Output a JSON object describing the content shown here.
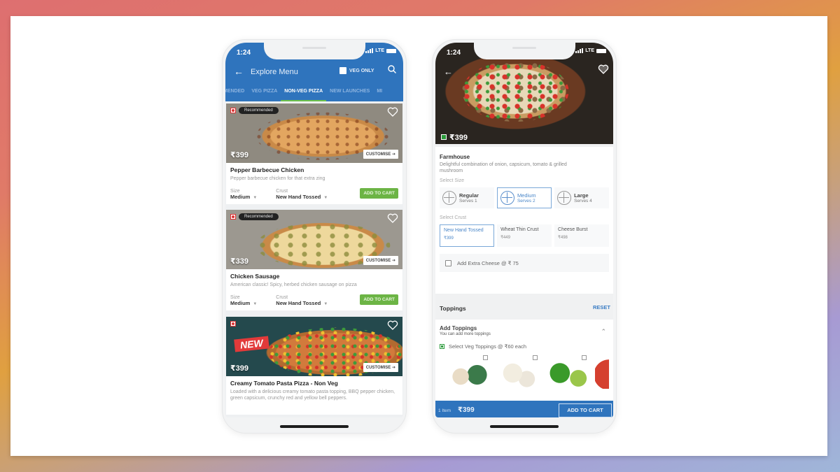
{
  "left_phone": {
    "status": {
      "time": "1:24",
      "network": "LTE"
    },
    "header": {
      "title": "Explore Menu",
      "veg_only_label": "VEG ONLY",
      "veg_only_checked": false
    },
    "tabs": [
      {
        "label": "RECOMMENDED",
        "visible_text": "MENDED",
        "active": false
      },
      {
        "label": "VEG PIZZA",
        "active": false
      },
      {
        "label": "NON-VEG PIZZA",
        "active": true
      },
      {
        "label": "NEW LAUNCHES",
        "active": false
      },
      {
        "label": "MI",
        "active": false
      }
    ],
    "items": [
      {
        "badge": "Recommended",
        "price": "₹399",
        "customise_label": "CUSTOMISE ➔",
        "name": "Pepper Barbecue Chicken",
        "description": "Pepper barbecue chicken for that extra zing",
        "size_label": "Size",
        "size_value": "Medium",
        "crust_label": "Crust",
        "crust_value": "New Hand Tossed",
        "add_to_cart": "ADD TO CART"
      },
      {
        "badge": "Recommended",
        "price": "₹339",
        "customise_label": "CUSTOMISE ➔",
        "name": "Chicken Sausage",
        "description": "American classic! Spicy, herbed chicken sausage on pizza",
        "size_label": "Size",
        "size_value": "Medium",
        "crust_label": "Crust",
        "crust_value": "New Hand Tossed",
        "add_to_cart": "ADD TO CART"
      },
      {
        "badge": "NEW",
        "price": "₹399",
        "customise_label": "CUSTOMISE ➔",
        "name": "Creamy Tomato Pasta Pizza - Non Veg",
        "description": "Loaded with a delicious creamy tomato pasta topping, BBQ pepper chicken, green capsicum, crunchy red and yellow bell peppers."
      }
    ]
  },
  "right_phone": {
    "status": {
      "time": "1:24",
      "network": "LTE"
    },
    "hero_price": "₹399",
    "pizza": {
      "name": "Farmhouse",
      "description": "Delightful combination of onion, capsicum, tomato & grilled mushroom"
    },
    "select_size_label": "Select Size",
    "sizes": [
      {
        "name": "Regular",
        "serves": "Serves 1",
        "selected": false
      },
      {
        "name": "Medium",
        "serves": "Serves 2",
        "selected": true
      },
      {
        "name": "Large",
        "serves": "Serves 4",
        "selected": false
      }
    ],
    "select_crust_label": "Select Crust",
    "crusts": [
      {
        "name": "New Hand Tossed",
        "price": "₹399",
        "selected": true
      },
      {
        "name": "Wheat Thin Crust",
        "price": "₹449",
        "selected": false
      },
      {
        "name": "Cheese Burst",
        "price": "₹498",
        "selected": false
      }
    ],
    "extra_cheese_label": "Add Extra Cheese @ ₹ 75",
    "extra_cheese_checked": false,
    "toppings_title": "Toppings",
    "reset_label": "RESET",
    "add_toppings": {
      "title": "Add Toppings",
      "subtitle": "You can add more toppings",
      "veg_toppings_label": "Select Veg Toppings @ ₹60 each",
      "thumbs": [
        "mushroom",
        "onion",
        "capsicum",
        "tomato"
      ]
    },
    "cart": {
      "items": "1 Item",
      "price": "₹399",
      "button": "ADD TO CART"
    }
  },
  "colors": {
    "brand_blue": "#2f74bd",
    "cart_green": "#6cb445",
    "active_tab_underline": "#6cc04a",
    "nonveg_red": "#dd3333",
    "veg_green": "#2a9a3a"
  }
}
